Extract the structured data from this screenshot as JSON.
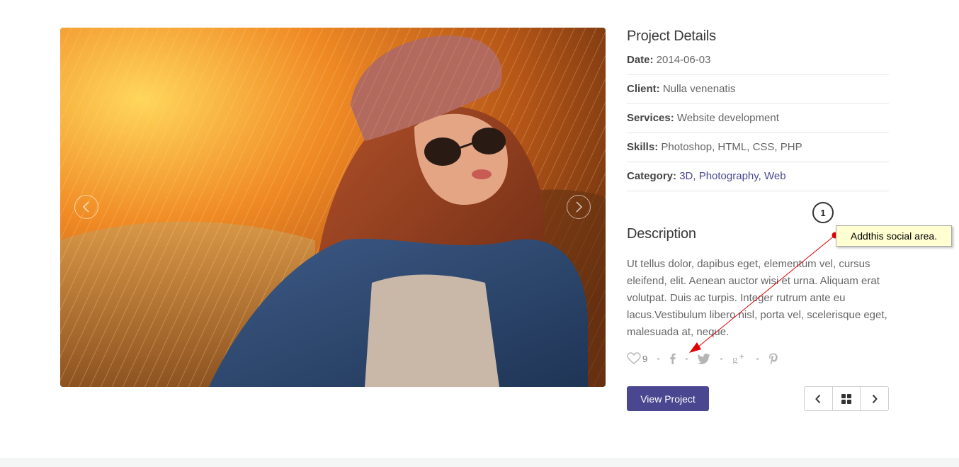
{
  "project": {
    "details_title": "Project Details",
    "meta": [
      {
        "label": "Date:",
        "value": "2014-06-03",
        "is_link": false
      },
      {
        "label": "Client:",
        "value": "Nulla venenatis",
        "is_link": false
      },
      {
        "label": "Services:",
        "value": "Website development",
        "is_link": false
      },
      {
        "label": "Skills:",
        "value": "Photoshop, HTML, CSS, PHP",
        "is_link": false
      },
      {
        "label": "Category:",
        "value": "3D, Photography, Web",
        "is_link": true
      }
    ],
    "description_title": "Description",
    "description": "Ut tellus dolor, dapibus eget, elementum vel, cursus eleifend, elit. Aenean auctor wisi et urna. Aliquam erat volutpat. Duis ac turpis. Integer rutrum ante eu lacus.Vestibulum libero nisl, porta vel, scelerisque eget, malesuada at, neque."
  },
  "social": {
    "likes_count": "9",
    "icons": [
      "heart-icon",
      "facebook-icon",
      "twitter-icon",
      "google-plus-icon",
      "pinterest-icon"
    ]
  },
  "actions": {
    "view_project_label": "View Project",
    "pager_icons": [
      "chevron-left-icon",
      "grid-icon",
      "chevron-right-icon"
    ]
  },
  "annotation": {
    "number": "1",
    "text": "Addthis social area."
  },
  "colors": {
    "accent": "#4a4790",
    "annotation_bg": "#ffffd2",
    "annotation_arrow": "#e00000"
  }
}
